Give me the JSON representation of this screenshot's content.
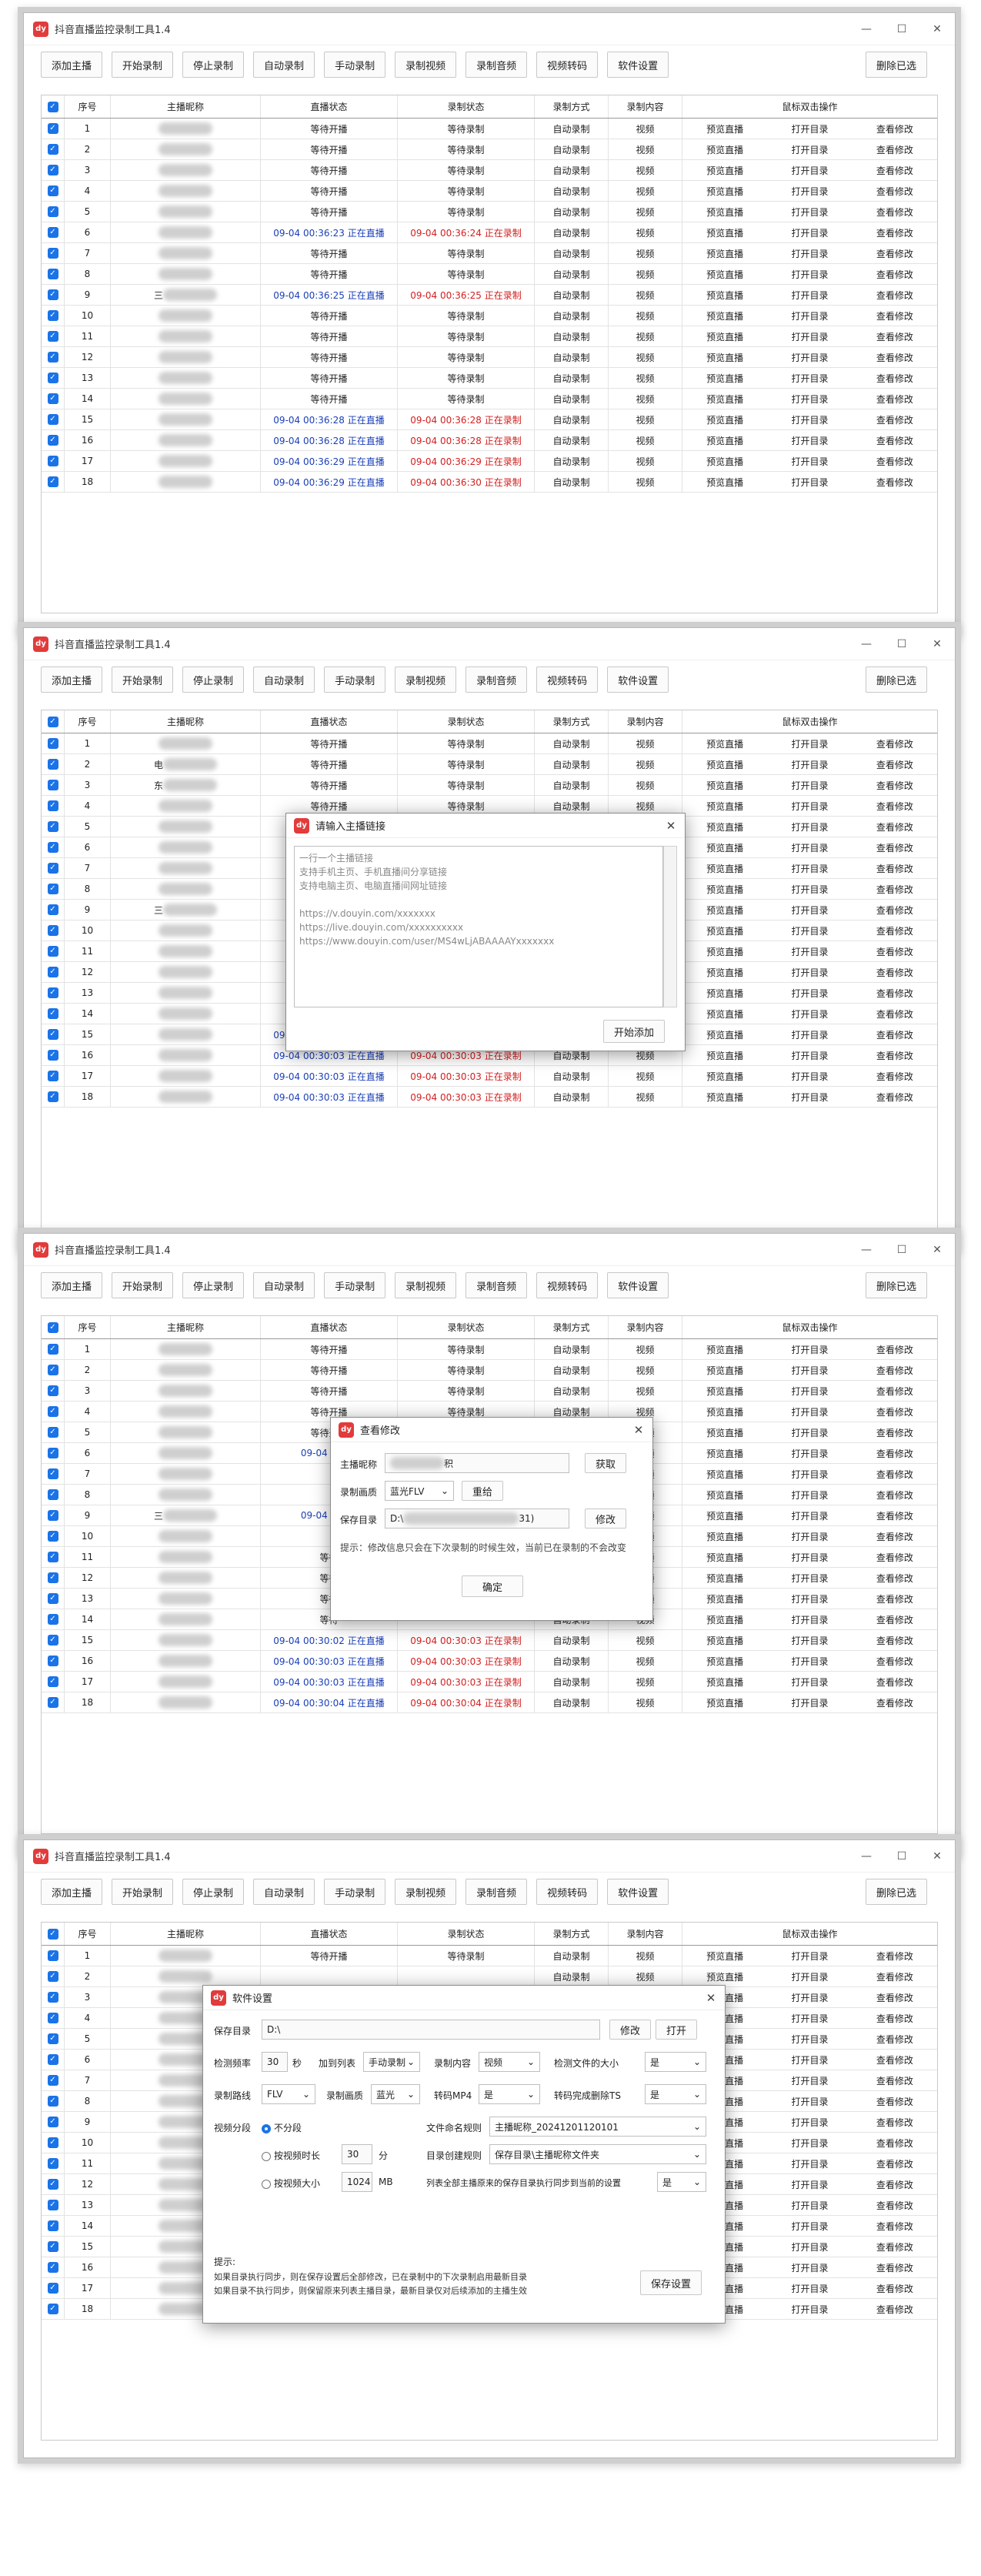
{
  "app": {
    "title": "抖音直播监控录制工具1.4",
    "logo": "dy"
  },
  "toolbar": [
    "添加主播",
    "开始录制",
    "停止录制",
    "自动录制",
    "手动录制",
    "录制视频",
    "录制音频",
    "视频转码",
    "软件设置"
  ],
  "delete_selected": "删除已选",
  "columns": [
    "序号",
    "主播昵称",
    "直播状态",
    "录制状态",
    "录制方式",
    "录制内容",
    "鼠标双击操作"
  ],
  "ops": [
    "预览直播",
    "打开目录",
    "查看修改"
  ],
  "texts": {
    "waiting_live": "等待开播",
    "waiting_rec": "等待录制",
    "auto": "自动录制",
    "video": "视频"
  },
  "panels": [
    {
      "rows": [
        {
          "n": "1",
          "name": "",
          "live": "等待开播",
          "rec": "等待录制"
        },
        {
          "n": "2",
          "name": "",
          "live": "等待开播",
          "rec": "等待录制"
        },
        {
          "n": "3",
          "name": "",
          "live": "等待开播",
          "rec": "等待录制"
        },
        {
          "n": "4",
          "name": "",
          "live": "等待开播",
          "rec": "等待录制"
        },
        {
          "n": "5",
          "name": "",
          "live": "等待开播",
          "rec": "等待录制"
        },
        {
          "n": "6",
          "name": "",
          "live": "09-04 00:36:23 正在直播",
          "rec": "09-04 00:36:24 正在录制"
        },
        {
          "n": "7",
          "name": "",
          "live": "等待开播",
          "rec": "等待录制"
        },
        {
          "n": "8",
          "name": "",
          "live": "等待开播",
          "rec": "等待录制"
        },
        {
          "n": "9",
          "name": "三",
          "live": "09-04 00:36:25 正在直播",
          "rec": "09-04 00:36:25 正在录制"
        },
        {
          "n": "10",
          "name": "",
          "live": "等待开播",
          "rec": "等待录制"
        },
        {
          "n": "11",
          "name": "",
          "live": "等待开播",
          "rec": "等待录制"
        },
        {
          "n": "12",
          "name": "",
          "live": "等待开播",
          "rec": "等待录制"
        },
        {
          "n": "13",
          "name": "",
          "live": "等待开播",
          "rec": "等待录制"
        },
        {
          "n": "14",
          "name": "",
          "live": "等待开播",
          "rec": "等待录制"
        },
        {
          "n": "15",
          "name": "",
          "live": "09-04 00:36:28 正在直播",
          "rec": "09-04 00:36:28 正在录制"
        },
        {
          "n": "16",
          "name": "",
          "live": "09-04 00:36:28 正在直播",
          "rec": "09-04 00:36:28 正在录制"
        },
        {
          "n": "17",
          "name": "",
          "live": "09-04 00:36:29 正在直播",
          "rec": "09-04 00:36:29 正在录制"
        },
        {
          "n": "18",
          "name": "",
          "live": "09-04 00:36:29 正在直播",
          "rec": "09-04 00:36:30 正在录制"
        }
      ]
    },
    {
      "rows": [
        {
          "n": "1",
          "name": "",
          "live": "等待开播",
          "rec": "等待录制"
        },
        {
          "n": "2",
          "name": "电",
          "live": "等待开播",
          "rec": "等待录制"
        },
        {
          "n": "3",
          "name": "东",
          "live": "等待开播",
          "rec": "等待录制"
        },
        {
          "n": "4",
          "name": "",
          "live": "等待开播",
          "rec": "等待录制"
        },
        {
          "n": "5",
          "name": "",
          "live": "等待开播",
          "rec": "等待录制"
        },
        {
          "n": "6",
          "name": "",
          "live": "09-04",
          "rec": ""
        },
        {
          "n": "7",
          "name": "",
          "live": "",
          "rec": ""
        },
        {
          "n": "8",
          "name": "",
          "live": "",
          "rec": ""
        },
        {
          "n": "9",
          "name": "三",
          "live": "",
          "rec": ""
        },
        {
          "n": "10",
          "name": "",
          "live": "",
          "rec": ""
        },
        {
          "n": "11",
          "name": "",
          "live": "",
          "rec": ""
        },
        {
          "n": "12",
          "name": "",
          "live": "",
          "rec": ""
        },
        {
          "n": "13",
          "name": "",
          "live": "",
          "rec": ""
        },
        {
          "n": "14",
          "name": "",
          "live": "等待开播",
          "rec": "等待录制"
        },
        {
          "n": "15",
          "name": "",
          "live": "09-04 00:30:03 正在直播",
          "rec": "09-04 00:30:03 正在录制"
        },
        {
          "n": "16",
          "name": "",
          "live": "09-04 00:30:03 正在直播",
          "rec": "09-04 00:30:03 正在录制"
        },
        {
          "n": "17",
          "name": "",
          "live": "09-04 00:30:03 正在直播",
          "rec": "09-04 00:30:03 正在录制"
        },
        {
          "n": "18",
          "name": "",
          "live": "09-04 00:30:03 正在直播",
          "rec": "09-04 00:30:03 正在录制"
        }
      ]
    },
    {
      "rows": [
        {
          "n": "1",
          "name": "",
          "live": "等待开播",
          "rec": "等待录制"
        },
        {
          "n": "2",
          "name": "",
          "live": "等待开播",
          "rec": "等待录制"
        },
        {
          "n": "3",
          "name": "",
          "live": "等待开播",
          "rec": "等待录制"
        },
        {
          "n": "4",
          "name": "",
          "live": "等待开播",
          "rec": "等待录制"
        },
        {
          "n": "5",
          "name": "",
          "live": "等待开播",
          "rec": "等待录制"
        },
        {
          "n": "6",
          "name": "",
          "live": "09-04 00:29",
          "rec": ""
        },
        {
          "n": "7",
          "name": "",
          "live": "",
          "rec": ""
        },
        {
          "n": "8",
          "name": "",
          "live": "",
          "rec": ""
        },
        {
          "n": "9",
          "name": "三",
          "live": "09-04 00:29",
          "rec": ""
        },
        {
          "n": "10",
          "name": "",
          "live": "",
          "rec": ""
        },
        {
          "n": "11",
          "name": "",
          "live": "等待",
          "rec": ""
        },
        {
          "n": "12",
          "name": "",
          "live": "等待",
          "rec": ""
        },
        {
          "n": "13",
          "name": "",
          "live": "等待",
          "rec": ""
        },
        {
          "n": "14",
          "name": "",
          "live": "等待",
          "rec": ""
        },
        {
          "n": "15",
          "name": "",
          "live": "09-04 00:30:02 正在直播",
          "rec": "09-04 00:30:03 正在录制"
        },
        {
          "n": "16",
          "name": "",
          "live": "09-04 00:30:03 正在直播",
          "rec": "09-04 00:30:03 正在录制"
        },
        {
          "n": "17",
          "name": "",
          "live": "09-04 00:30:03 正在直播",
          "rec": "09-04 00:30:03 正在录制"
        },
        {
          "n": "18",
          "name": "",
          "live": "09-04 00:30:04 正在直播",
          "rec": "09-04 00:30:04 正在录制"
        }
      ]
    },
    {
      "rows": [
        {
          "n": "1",
          "name": "",
          "live": "等待开播",
          "rec": "等待录制"
        },
        {
          "n": "2",
          "name": "",
          "live": "",
          "rec": ""
        },
        {
          "n": "3",
          "name": "",
          "live": "",
          "rec": ""
        },
        {
          "n": "4",
          "name": "",
          "live": "",
          "rec": ""
        },
        {
          "n": "5",
          "name": "",
          "live": "",
          "rec": ""
        },
        {
          "n": "6",
          "name": "",
          "live": "",
          "rec": ""
        },
        {
          "n": "7",
          "name": "",
          "live": "",
          "rec": ""
        },
        {
          "n": "8",
          "name": "",
          "live": "",
          "rec": ""
        },
        {
          "n": "9",
          "name": "",
          "live": "",
          "rec": ""
        },
        {
          "n": "10",
          "name": "",
          "live": "",
          "rec": ""
        },
        {
          "n": "11",
          "name": "",
          "live": "",
          "rec": ""
        },
        {
          "n": "12",
          "name": "",
          "live": "",
          "rec": ""
        },
        {
          "n": "13",
          "name": "",
          "live": "",
          "rec": ""
        },
        {
          "n": "14",
          "name": "",
          "live": "",
          "rec": ""
        },
        {
          "n": "15",
          "name": "",
          "live": "",
          "rec": ""
        },
        {
          "n": "16",
          "name": "",
          "live": "",
          "rec": ""
        },
        {
          "n": "17",
          "name": "",
          "live": "",
          "rec": ""
        },
        {
          "n": "18",
          "name": "",
          "live": "09-04 00:30:04 正在直播",
          "rec": "09-04 00:30:04 正在录制"
        }
      ]
    }
  ],
  "dialog_add": {
    "title": "请输入主播链接",
    "placeholder": "一行一个主播链接\n支持手机主页、手机直播间分享链接\n支持电脑主页、电脑直播间网址链接\n\nhttps://v.douyin.com/xxxxxxx\nhttps://live.douyin.com/xxxxxxxxxx\nhttps://www.douyin.com/user/MS4wLjABAAAAYxxxxxxx",
    "button": "开始添加"
  },
  "dialog_edit": {
    "title": "查看修改",
    "name_label": "主播昵称",
    "name_suffix": "积",
    "get_btn": "获取",
    "quality_label": "录制画质",
    "quality_value": "蓝光FLV",
    "refresh_btn": "重给",
    "dir_label": "保存目录",
    "dir_value": "D:\\",
    "dir_suffix": "31)",
    "modify_btn": "修改",
    "tip": "提示：修改信息只会在下次录制的时候生效，当前已在录制的不会改变",
    "ok_btn": "确定"
  },
  "dialog_settings": {
    "title": "软件设置",
    "save_dir_label": "保存目录",
    "save_dir_value": "D:\\",
    "modify_btn": "修改",
    "open_btn": "打开",
    "interval_label": "检测频率",
    "interval_value": "30",
    "interval_unit": "秒",
    "join_list_label": "加到列表",
    "join_list_value": "手动录制",
    "content_label": "录制内容",
    "content_value": "视频",
    "check_size_label": "检测文件的大小",
    "check_size_value": "是",
    "line_label": "录制路线",
    "line_value": "FLV",
    "quality_label": "录制画质",
    "quality_value": "蓝光",
    "mp4_label": "转码MP4",
    "mp4_value": "是",
    "del_ts_label": "转码完成删除TS",
    "del_ts_value": "是",
    "split_label": "视频分段",
    "split_options": [
      "不分段",
      "按视频时长",
      "按视频大小"
    ],
    "duration_value": "30",
    "duration_unit": "分",
    "size_value": "1024",
    "size_unit": "MB",
    "filename_label": "文件命名规则",
    "filename_value": "主播昵称_20241201120101",
    "dir_rule_label": "目录创建规则",
    "dir_rule_value": "保存目录\\主播昵称文件夹",
    "sync_label": "列表全部主播原来的保存目录执行同步到当前的设置",
    "sync_value": "是",
    "tip_title": "提示:",
    "tip_text": "如果目录执行同步，则在保存设置后全部修改，已在录制中的下次录制启用最新目录\n如果目录不执行同步，则保留原来列表主播目录，最新目录仅对后续添加的主播生效",
    "save_btn": "保存设置"
  },
  "colors": {
    "accent": "#1a73e8",
    "live_blue": "#1a3fb8",
    "rec_red": "#d41e1e",
    "logo_red": "#e23b3b"
  }
}
